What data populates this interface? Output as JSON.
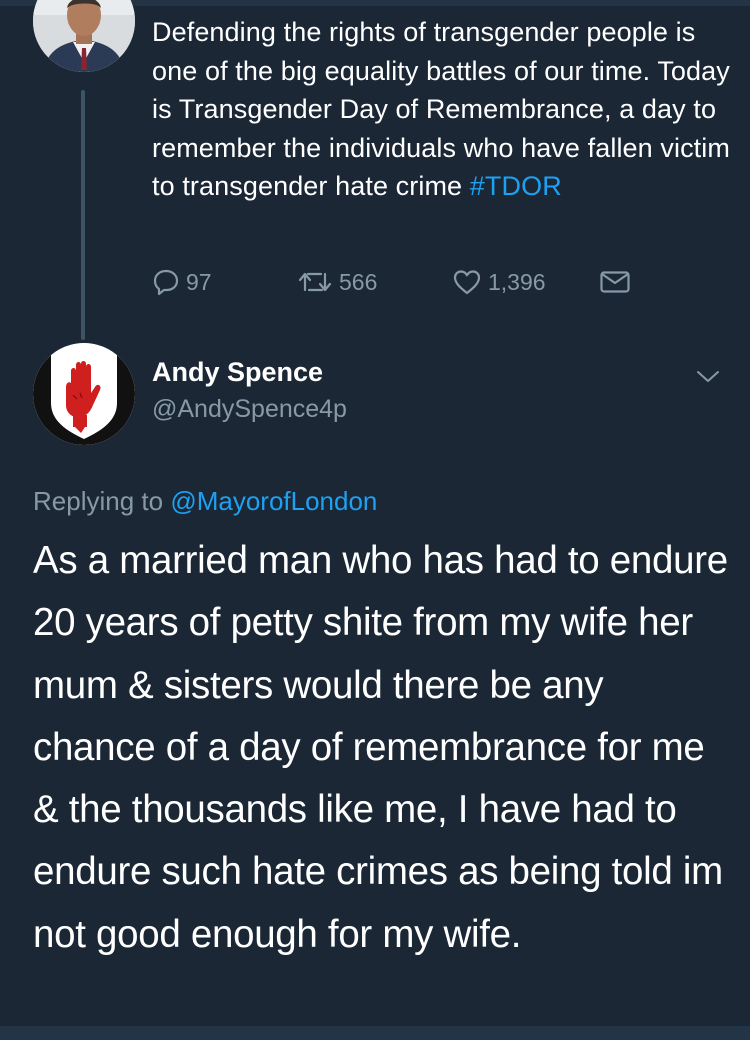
{
  "parent_tweet": {
    "text": "Defending the rights of transgender people is one of the big equality battles of our time. Today is Transgender Day of Remembrance, a day to remember the individuals who have fallen victim to transgender hate crime ",
    "hashtag": "#TDOR",
    "replies": "97",
    "retweets": "566",
    "likes": "1,396",
    "icons": {
      "reply": "reply-icon",
      "retweet": "retweet-icon",
      "like": "heart-icon",
      "message": "envelope-icon"
    }
  },
  "reply_tweet": {
    "author_name": "Andy Spence",
    "author_handle": "@AndySpence4p",
    "replying_prefix": "Replying to ",
    "replying_to": "@MayorofLondon",
    "text": "As a married man who has had to endure 20 years of petty shite from my wife her mum & sisters would there be any chance of a day of remembrance for me & the thousands like me, I have had to endure such hate crimes as being told im not good enough for my wife.",
    "menu_icon": "chevron-down-icon"
  },
  "colors": {
    "background": "#1b2735",
    "text": "#ffffff",
    "secondary": "#8899a6",
    "accent": "#1da1f2",
    "thread_line": "#3d5466"
  }
}
